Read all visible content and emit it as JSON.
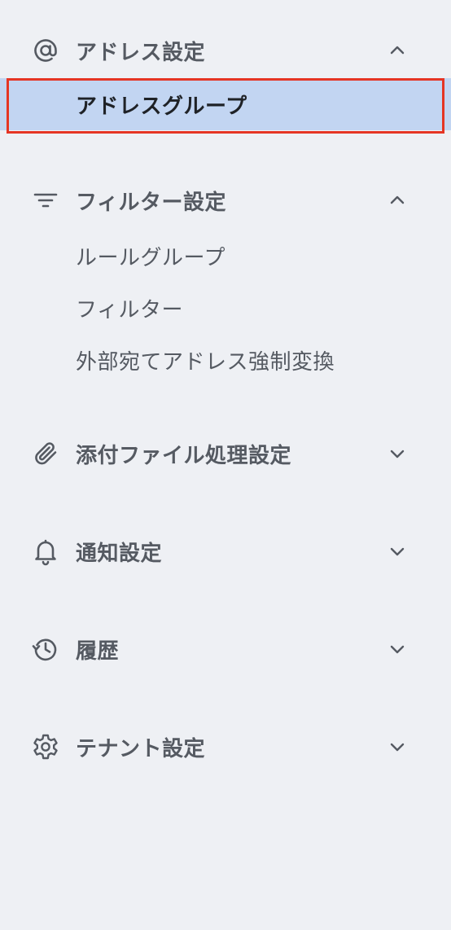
{
  "sections": [
    {
      "label": "アドレス設定",
      "icon": "at-sign-icon",
      "expanded": true,
      "items": [
        {
          "label": "アドレスグループ",
          "active": true
        }
      ]
    },
    {
      "label": "フィルター設定",
      "icon": "filter-icon",
      "expanded": true,
      "items": [
        {
          "label": "ルールグループ",
          "active": false
        },
        {
          "label": "フィルター",
          "active": false
        },
        {
          "label": "外部宛てアドレス強制変換",
          "active": false
        }
      ]
    },
    {
      "label": "添付ファイル処理設定",
      "icon": "paperclip-icon",
      "expanded": false,
      "items": []
    },
    {
      "label": "通知設定",
      "icon": "bell-icon",
      "expanded": false,
      "items": []
    },
    {
      "label": "履歴",
      "icon": "history-icon",
      "expanded": false,
      "items": []
    },
    {
      "label": "テナント設定",
      "icon": "gear-icon",
      "expanded": false,
      "items": []
    }
  ],
  "colors": {
    "background": "#eef0f4",
    "active_background": "#c2d5f2",
    "highlight_border": "#e53524",
    "text": "#555a62",
    "active_text": "#1f2227"
  }
}
